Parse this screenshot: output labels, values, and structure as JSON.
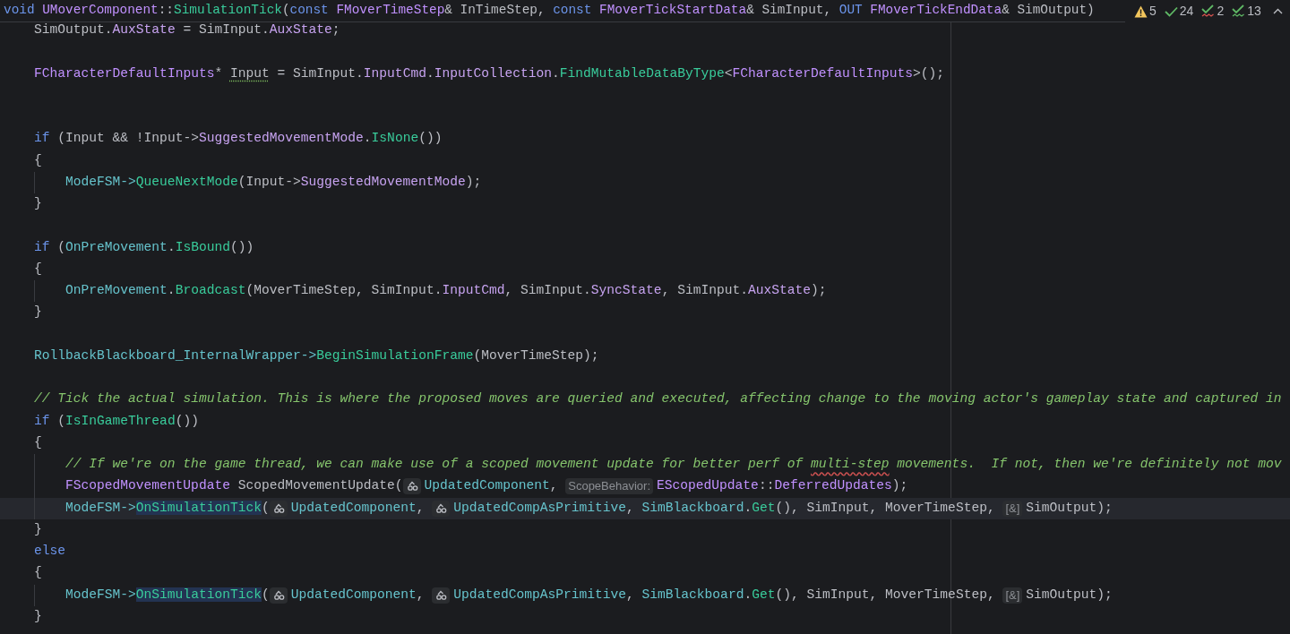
{
  "header": {
    "tokens": [
      {
        "text": "void ",
        "kind": "kw"
      },
      {
        "text": "UMoverComponent",
        "kind": "type"
      },
      {
        "text": "::",
        "kind": "plain"
      },
      {
        "text": "SimulationTick",
        "kind": "fn"
      },
      {
        "text": "(",
        "kind": "plain"
      },
      {
        "text": "const ",
        "kind": "kw"
      },
      {
        "text": "FMoverTimeStep",
        "kind": "type"
      },
      {
        "text": "& InTimeStep, ",
        "kind": "plain"
      },
      {
        "text": "const ",
        "kind": "kw"
      },
      {
        "text": "FMoverTickStartData",
        "kind": "type"
      },
      {
        "text": "& SimInput, ",
        "kind": "plain"
      },
      {
        "text": "OUT ",
        "kind": "kw"
      },
      {
        "text": "FMoverTickEndData",
        "kind": "type"
      },
      {
        "text": "& SimOutput)",
        "kind": "plain"
      }
    ]
  },
  "indicators": [
    {
      "kind": "warning",
      "count": "5"
    },
    {
      "kind": "ok",
      "count": "24"
    },
    {
      "kind": "typo",
      "count": "2"
    },
    {
      "kind": "grammar",
      "count": "13"
    }
  ],
  "lines": [
    {
      "kind": "code",
      "tokens": [
        {
          "text": "SimOutput.",
          "kind": "plain"
        },
        {
          "text": "AuxState",
          "kind": "member"
        },
        {
          "text": " = SimInput.",
          "kind": "plain"
        },
        {
          "text": "AuxState",
          "kind": "member"
        },
        {
          "text": ";",
          "kind": "plain"
        }
      ]
    },
    {
      "kind": "blank"
    },
    {
      "kind": "code",
      "tokens": [
        {
          "text": "FCharacterDefaultInputs",
          "kind": "type"
        },
        {
          "text": "* ",
          "kind": "plain"
        },
        {
          "text": "Input",
          "kind": "plain",
          "weak_warning": true
        },
        {
          "text": " = SimInput.",
          "kind": "plain"
        },
        {
          "text": "InputCmd",
          "kind": "member"
        },
        {
          "text": ".",
          "kind": "plain"
        },
        {
          "text": "InputCollection",
          "kind": "member"
        },
        {
          "text": ".",
          "kind": "plain"
        },
        {
          "text": "FindMutableDataByType",
          "kind": "fn"
        },
        {
          "text": "<",
          "kind": "plain"
        },
        {
          "text": "FCharacterDefaultInputs",
          "kind": "type"
        },
        {
          "text": ">();",
          "kind": "plain"
        }
      ]
    },
    {
      "kind": "blank"
    },
    {
      "kind": "blank"
    },
    {
      "kind": "code",
      "tokens": [
        {
          "text": "if",
          "kind": "kw"
        },
        {
          "text": " (Input && !Input->",
          "kind": "plain"
        },
        {
          "text": "SuggestedMovementMode",
          "kind": "member"
        },
        {
          "text": ".",
          "kind": "plain"
        },
        {
          "text": "IsNone",
          "kind": "fn"
        },
        {
          "text": "())",
          "kind": "plain"
        }
      ]
    },
    {
      "kind": "code",
      "tokens": [
        {
          "text": "{",
          "kind": "plain"
        }
      ],
      "children": [
        {
          "kind": "code",
          "tokens": [
            {
              "text": "ModeFSM->",
              "kind": "field"
            },
            {
              "text": "QueueNextMode",
              "kind": "fn"
            },
            {
              "text": "(Input->",
              "kind": "plain"
            },
            {
              "text": "SuggestedMovementMode",
              "kind": "member"
            },
            {
              "text": ");",
              "kind": "plain"
            }
          ]
        }
      ]
    },
    {
      "kind": "code",
      "tokens": [
        {
          "text": "}",
          "kind": "plain"
        }
      ]
    },
    {
      "kind": "blank"
    },
    {
      "kind": "code",
      "tokens": [
        {
          "text": "if",
          "kind": "kw"
        },
        {
          "text": " (",
          "kind": "plain"
        },
        {
          "text": "OnPreMovement",
          "kind": "field"
        },
        {
          "text": ".",
          "kind": "plain"
        },
        {
          "text": "IsBound",
          "kind": "fn"
        },
        {
          "text": "())",
          "kind": "plain"
        }
      ]
    },
    {
      "kind": "code",
      "tokens": [
        {
          "text": "{",
          "kind": "plain"
        }
      ],
      "children": [
        {
          "kind": "code",
          "tokens": [
            {
              "text": "OnPreMovement",
              "kind": "field"
            },
            {
              "text": ".",
              "kind": "plain"
            },
            {
              "text": "Broadcast",
              "kind": "fn"
            },
            {
              "text": "(MoverTimeStep, SimInput.",
              "kind": "plain"
            },
            {
              "text": "InputCmd",
              "kind": "member"
            },
            {
              "text": ", SimInput.",
              "kind": "plain"
            },
            {
              "text": "SyncState",
              "kind": "member"
            },
            {
              "text": ", SimInput.",
              "kind": "plain"
            },
            {
              "text": "AuxState",
              "kind": "member"
            },
            {
              "text": ");",
              "kind": "plain"
            }
          ]
        }
      ]
    },
    {
      "kind": "code",
      "tokens": [
        {
          "text": "}",
          "kind": "plain"
        }
      ]
    },
    {
      "kind": "blank"
    },
    {
      "kind": "code",
      "tokens": [
        {
          "text": "RollbackBlackboard_InternalWrapper->",
          "kind": "field"
        },
        {
          "text": "BeginSimulationFrame",
          "kind": "fn"
        },
        {
          "text": "(MoverTimeStep);",
          "kind": "plain"
        }
      ]
    },
    {
      "kind": "blank"
    },
    {
      "kind": "code",
      "tokens": [
        {
          "text": "// Tick the actual simulation. This is where the proposed moves are queried and executed, affecting change to the moving actor's gameplay state and captured in",
          "kind": "comment"
        }
      ]
    },
    {
      "kind": "code",
      "tokens": [
        {
          "text": "if",
          "kind": "kw"
        },
        {
          "text": " (",
          "kind": "plain"
        },
        {
          "text": "IsInGameThread",
          "kind": "fn"
        },
        {
          "text": "())",
          "kind": "plain"
        }
      ]
    },
    {
      "kind": "code",
      "tokens": [
        {
          "text": "{",
          "kind": "plain"
        }
      ],
      "children": [
        {
          "kind": "code",
          "tokens": [
            {
              "text": "// If we're on the game thread, we can make use of a scoped movement update for better perf of ",
              "kind": "comment"
            },
            {
              "text": "multi-step",
              "kind": "comment",
              "spelling_error": true
            },
            {
              "text": " movements.  If not, then we're definitely not mov",
              "kind": "comment"
            }
          ]
        },
        {
          "kind": "code",
          "tokens": [
            {
              "text": "FScopedMovementUpdate",
              "kind": "type"
            },
            {
              "text": " ScopedMovementUpdate(",
              "kind": "plain"
            },
            {
              "text": "UpdatedComponent",
              "kind": "field",
              "ref": true
            },
            {
              "text": ", ",
              "kind": "plain"
            },
            {
              "text": "ScopeBehavior:",
              "kind": "hint"
            },
            {
              "text": "EScopedUpdate",
              "kind": "type"
            },
            {
              "text": "::",
              "kind": "plain"
            },
            {
              "text": "DeferredUpdates",
              "kind": "type"
            },
            {
              "text": ");",
              "kind": "plain"
            }
          ]
        },
        {
          "kind": "code",
          "current": true,
          "tokens": [
            {
              "text": "ModeFSM->",
              "kind": "field"
            },
            {
              "text": "OnSimulationTick",
              "kind": "fnhl"
            },
            {
              "text": "(",
              "kind": "plain"
            },
            {
              "text": "UpdatedComponent",
              "kind": "field",
              "ref": true
            },
            {
              "text": ", ",
              "kind": "plain"
            },
            {
              "text": "UpdatedCompAsPrimitive",
              "kind": "field",
              "ref": true
            },
            {
              "text": ", ",
              "kind": "plain"
            },
            {
              "text": "SimBlackboard",
              "kind": "field"
            },
            {
              "text": ".",
              "kind": "plain"
            },
            {
              "text": "Get",
              "kind": "fn"
            },
            {
              "text": "(), SimInput, MoverTimeStep, ",
              "kind": "plain"
            },
            {
              "text": "[&]",
              "kind": "hint"
            },
            {
              "text": "SimOutput);",
              "kind": "plain"
            }
          ]
        }
      ]
    },
    {
      "kind": "code",
      "tokens": [
        {
          "text": "}",
          "kind": "plain"
        }
      ]
    },
    {
      "kind": "code",
      "tokens": [
        {
          "text": "else",
          "kind": "kw"
        }
      ]
    },
    {
      "kind": "code",
      "tokens": [
        {
          "text": "{",
          "kind": "plain"
        }
      ],
      "children": [
        {
          "kind": "code",
          "tokens": [
            {
              "text": "ModeFSM->",
              "kind": "field"
            },
            {
              "text": "OnSimulationTick",
              "kind": "fnhl"
            },
            {
              "text": "(",
              "kind": "plain"
            },
            {
              "text": "UpdatedComponent",
              "kind": "field",
              "ref": true
            },
            {
              "text": ", ",
              "kind": "plain"
            },
            {
              "text": "UpdatedCompAsPrimitive",
              "kind": "field",
              "ref": true
            },
            {
              "text": ", ",
              "kind": "plain"
            },
            {
              "text": "SimBlackboard",
              "kind": "field"
            },
            {
              "text": ".",
              "kind": "plain"
            },
            {
              "text": "Get",
              "kind": "fn"
            },
            {
              "text": "(), SimInput, MoverTimeStep, ",
              "kind": "plain"
            },
            {
              "text": "[&]",
              "kind": "hint"
            },
            {
              "text": "SimOutput);",
              "kind": "plain"
            }
          ]
        }
      ]
    },
    {
      "kind": "code",
      "tokens": [
        {
          "text": "}",
          "kind": "plain"
        }
      ]
    }
  ]
}
